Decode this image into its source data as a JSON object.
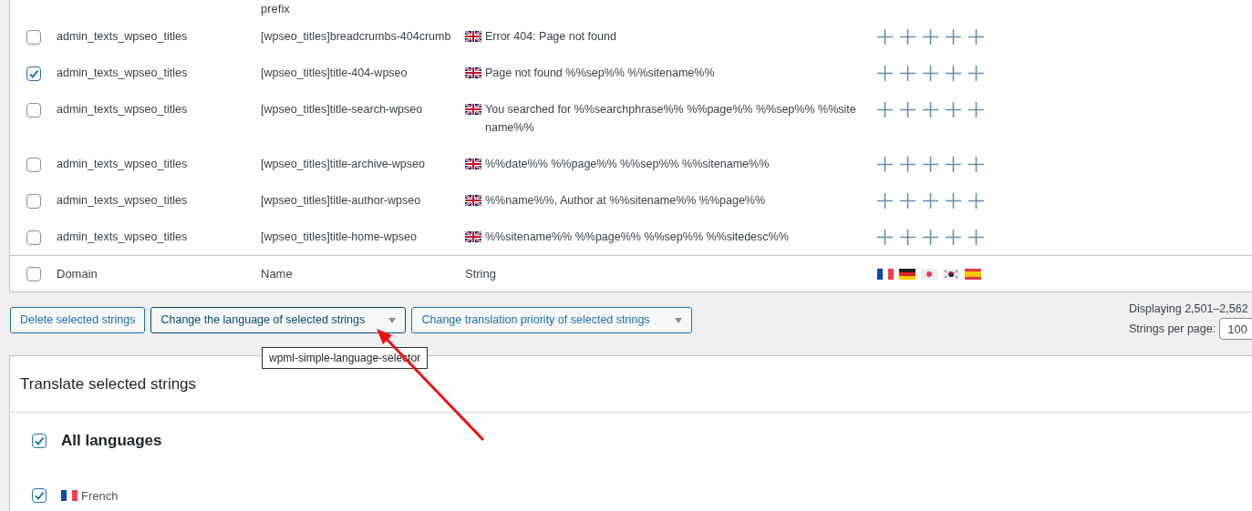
{
  "table": {
    "partial_row": {
      "name": "prefix"
    },
    "rows": [
      {
        "selected": false,
        "domain": "admin_texts_wpseo_titles",
        "name": "[wpseo_titles]breadcrumbs-404crumb",
        "string": "Error 404: Page not found"
      },
      {
        "selected": true,
        "domain": "admin_texts_wpseo_titles",
        "name": "[wpseo_titles]title-404-wpseo",
        "string": "Page not found %%sep%% %%sitename%%"
      },
      {
        "selected": false,
        "domain": "admin_texts_wpseo_titles",
        "name": "[wpseo_titles]title-search-wpseo",
        "string": "You searched for %%searchphrase%% %%page%% %%sep%% %%sitename%%"
      },
      {
        "selected": false,
        "domain": "admin_texts_wpseo_titles",
        "name": "[wpseo_titles]title-archive-wpseo",
        "string": "%%date%% %%page%% %%sep%% %%sitename%%"
      },
      {
        "selected": false,
        "domain": "admin_texts_wpseo_titles",
        "name": "[wpseo_titles]title-author-wpseo",
        "string": "%%name%%, Author at %%sitename%% %%page%%"
      },
      {
        "selected": false,
        "domain": "admin_texts_wpseo_titles",
        "name": "[wpseo_titles]title-home-wpseo",
        "string": "%%sitename%% %%page%% %%sep%% %%sitedesc%%"
      }
    ],
    "footer": {
      "selected": false,
      "columns": [
        "Domain",
        "Name",
        "String"
      ]
    }
  },
  "actions": [
    {
      "label": "Delete selected strings",
      "kind": "button"
    },
    {
      "label": "Change the language of selected strings",
      "kind": "select",
      "focused": true
    },
    {
      "label": "Change translation priority of selected strings",
      "kind": "select",
      "focused": false
    }
  ],
  "tooltip": "wpml-simple-language-selector",
  "pagination": {
    "displaying": "Displaying 2,501–2,562",
    "per_page_label": "Strings per page:",
    "per_page_value": "100"
  },
  "translate_panel": {
    "title": "Translate selected strings",
    "all_languages": {
      "label": "All languages",
      "checked": true
    },
    "languages": [
      {
        "label": "French",
        "checked": true
      }
    ]
  }
}
